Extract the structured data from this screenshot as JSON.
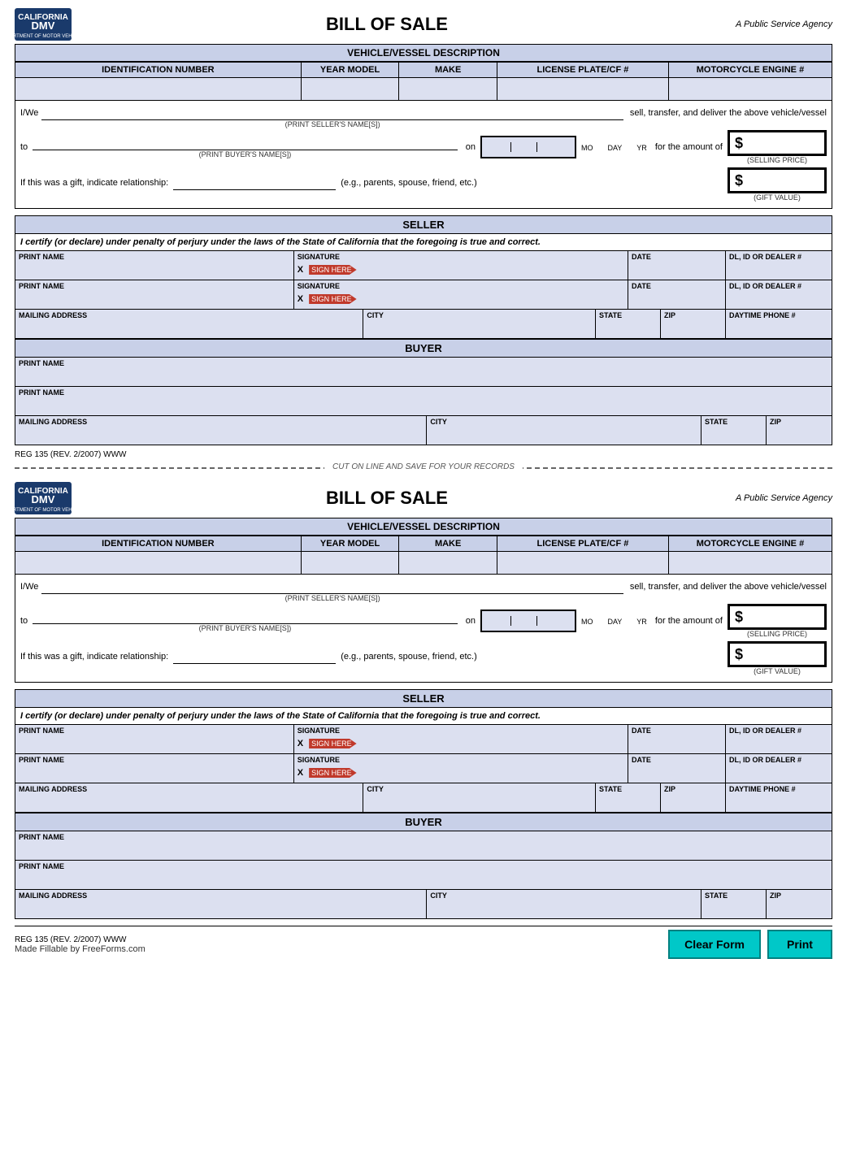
{
  "form": {
    "title": "BILL OF SALE",
    "agency": "A Public Service Agency",
    "vehicle_description_header": "VEHICLE/VESSEL DESCRIPTION",
    "columns": {
      "id_number": "IDENTIFICATION NUMBER",
      "year_model": "YEAR MODEL",
      "make": "MAKE",
      "license_plate": "LICENSE PLATE/CF #",
      "motorcycle_engine": "MOTORCYCLE ENGINE #"
    },
    "seller_text_1": "I/We",
    "seller_text_2": "sell, transfer, and deliver the above vehicle/vessel",
    "seller_name_label": "(PRINT SELLER'S NAME[S])",
    "to_text": "to",
    "on_text": "on",
    "buyer_name_label": "(PRINT BUYER'S NAME[S])",
    "date_labels": {
      "mo": "MO",
      "day": "DAY",
      "yr": "YR"
    },
    "for_amount_text": "for the amount of",
    "selling_price_label": "(SELLING PRICE)",
    "gift_text": "If this was a gift, indicate relationship:",
    "gift_example": "(e.g., parents, spouse, friend, etc.)",
    "gift_value_label": "(GIFT VALUE)",
    "dollar_sign": "$",
    "seller_section": "SELLER",
    "certify_text": "I certify (or declare) under penalty of perjury under the laws of the State of California that the foregoing is true and correct.",
    "print_name_label": "PRINT NAME",
    "signature_label": "SIGNATURE",
    "date_label": "DATE",
    "dl_label": "DL, ID OR DEALER #",
    "mailing_address_label": "MAILING ADDRESS",
    "city_label": "CITY",
    "state_label": "STATE",
    "zip_label": "ZIP",
    "phone_label": "DAYTIME PHONE #",
    "buyer_section": "BUYER",
    "reg_note": "REG 135 (REV. 2/2007) WWW",
    "cut_line_text": "CUT ON LINE AND SAVE FOR YOUR RECORDS",
    "made_fillable": "Made Fillable by FreeForms.com",
    "btn_clear": "Clear Form",
    "btn_print": "Print",
    "sig_label": "SIGN HERE",
    "x_label": "X"
  }
}
